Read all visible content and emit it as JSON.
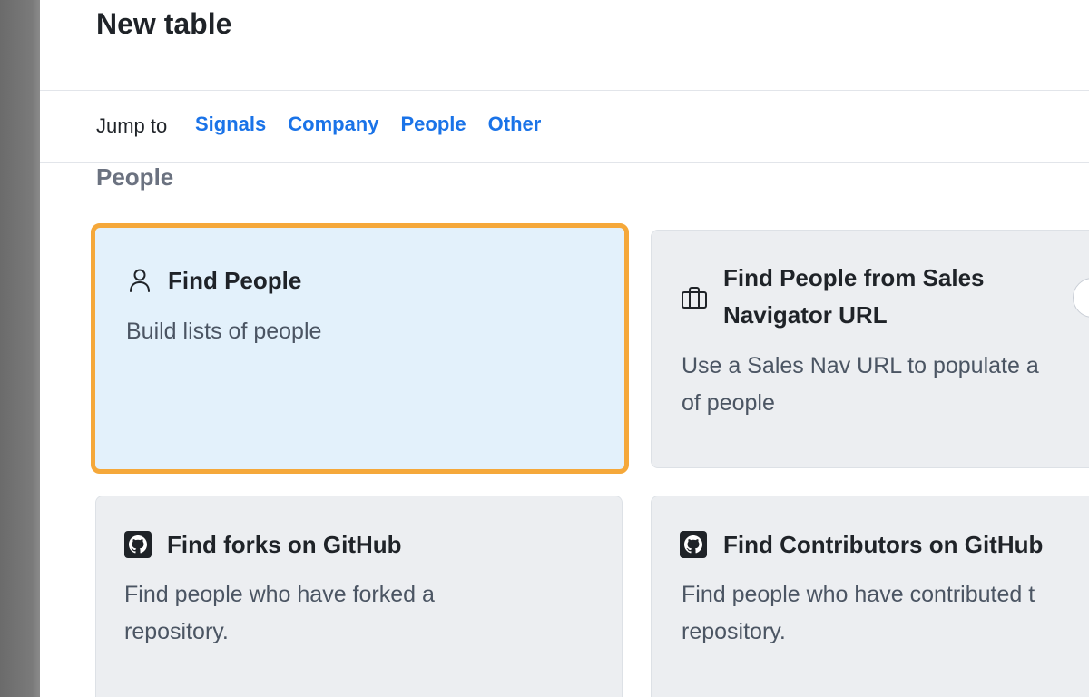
{
  "dialog": {
    "title": "New table"
  },
  "jump": {
    "label": "Jump to",
    "links": [
      "Signals",
      "Company",
      "People",
      "Other"
    ]
  },
  "section": {
    "title": "People"
  },
  "cards": [
    {
      "title": "Find People",
      "description": "Build lists of people",
      "icon": "person-icon",
      "selected": true
    },
    {
      "title_line1": "Find People from Sales",
      "title_line2": "Navigator URL",
      "description_line1": "Use a Sales Nav URL to populate a",
      "description_line2": "of people",
      "icon": "briefcase-icon",
      "selected": false
    },
    {
      "title": "Find forks on GitHub",
      "description_line1": "Find people who have forked a",
      "description_line2": "repository.",
      "icon": "github-icon",
      "selected": false
    },
    {
      "title": "Find Contributors on GitHub",
      "description_line1": "Find people who have contributed t",
      "description_line2": "repository.",
      "icon": "github-icon",
      "selected": false
    }
  ],
  "colors": {
    "accent_link": "#1a73e8",
    "selected_border": "#f5a83a",
    "selected_bg": "#e3f1fb",
    "card_bg": "#eceef1"
  }
}
